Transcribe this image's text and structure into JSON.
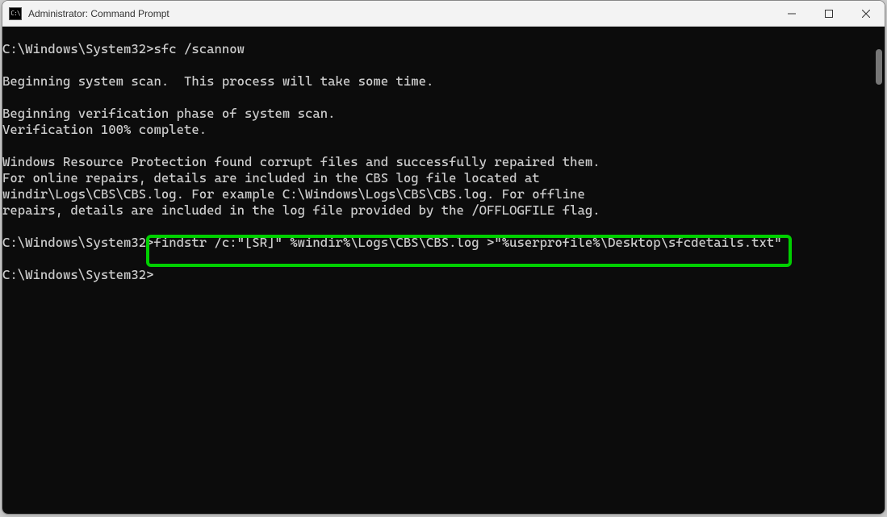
{
  "window": {
    "title": "Administrator: Command Prompt",
    "icon_label": "C:\\_"
  },
  "terminal": {
    "prompt1": "C:\\Windows\\System32>",
    "cmd1": "sfc /scannow",
    "blank": "",
    "l1": "Beginning system scan.  This process will take some time.",
    "l2": "Beginning verification phase of system scan.",
    "l3": "Verification 100% complete.",
    "l4": "Windows Resource Protection found corrupt files and successfully repaired them.",
    "l5": "For online repairs, details are included in the CBS log file located at",
    "l6": "windir\\Logs\\CBS\\CBS.log. For example C:\\Windows\\Logs\\CBS\\CBS.log. For offline",
    "l7": "repairs, details are included in the log file provided by the /OFFLOGFILE flag.",
    "prompt2": "C:\\Windows\\System32>",
    "cmd2": "findstr /c:\"[SR]\" %windir%\\Logs\\CBS\\CBS.log >\"%userprofile%\\Desktop\\sfcdetails.txt\"",
    "prompt3": "C:\\Windows\\System32>"
  }
}
